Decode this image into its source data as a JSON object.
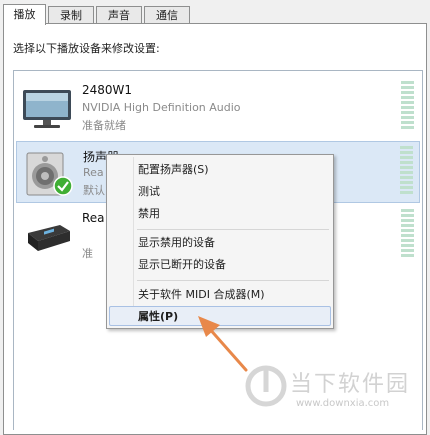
{
  "tabs": [
    "播放",
    "录制",
    "声音",
    "通信"
  ],
  "instruction": "选择以下播放设备来修改设置:",
  "devices": [
    {
      "name": "2480W1",
      "driver": "NVIDIA High Definition Audio",
      "status": "准备就绪",
      "icon": "monitor-icon"
    },
    {
      "name": "扬声器",
      "driver": "Rea",
      "status": "默认",
      "icon": "speaker-icon",
      "default_badge": "default-check-icon"
    },
    {
      "name": "Rea",
      "driver": "",
      "status": "准",
      "icon": "digital-output-icon"
    }
  ],
  "context_menu": {
    "items": [
      "配置扬声器(S)",
      "测试",
      "禁用",
      "显示禁用的设备",
      "显示已断开的设备",
      "关于软件 MIDI 合成器(M)",
      "属性(P)"
    ],
    "highlighted": "属性(P)"
  },
  "annotation": {
    "arrow_color": "#e8884a"
  },
  "watermark": {
    "title": "当下软件园",
    "url": "www.downxia.com"
  },
  "colors": {
    "selection": "#dbe8f6",
    "meter": "#bfe0cd",
    "default_check": "#3fae34"
  }
}
